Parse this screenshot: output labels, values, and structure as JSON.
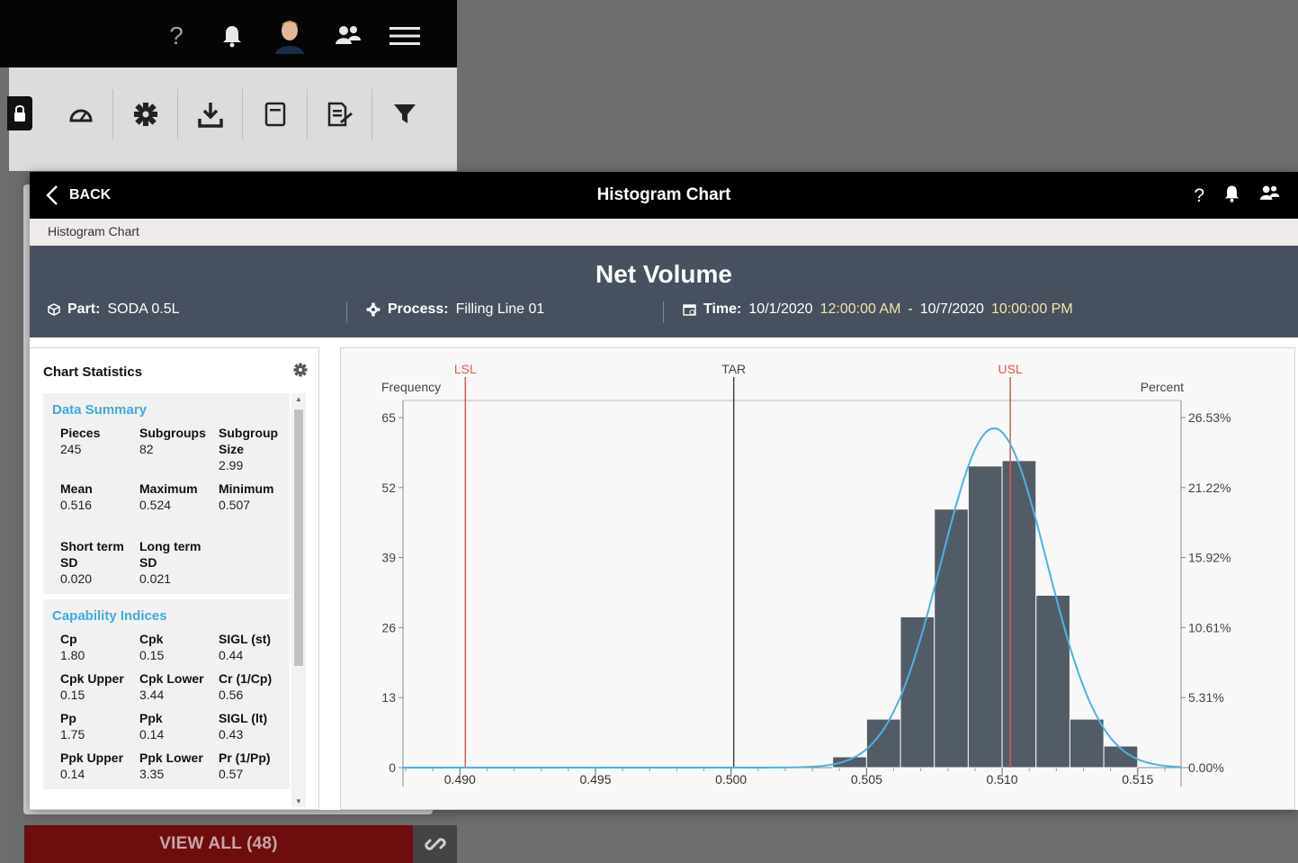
{
  "background": {
    "view_all_label": "VIEW ALL (48)",
    "topbar_icons": [
      "help-icon",
      "bell-icon",
      "avatar",
      "team-icon",
      "menu-icon"
    ],
    "help_glyph": "?",
    "toolbar_icons": [
      "lock-icon",
      "gauge-icon",
      "gear-icon",
      "download-icon",
      "report-icon",
      "edit-report-icon",
      "filter-icon"
    ]
  },
  "modal": {
    "back_label": "BACK",
    "title": "Histogram Chart",
    "help_glyph": "?",
    "breadcrumb": "Histogram Chart",
    "variable_name": "Net Volume",
    "part": {
      "label": "Part:",
      "value": "SODA 0.5L"
    },
    "process": {
      "label": "Process:",
      "value": "Filling Line 01"
    },
    "time": {
      "label": "Time:",
      "start_date": "10/1/2020",
      "start_time": "12:00:00 AM",
      "dash": "-",
      "end_date": "10/7/2020",
      "end_time": "10:00:00 PM"
    }
  },
  "stats": {
    "title": "Chart Statistics",
    "data_summary": {
      "title": "Data Summary",
      "items": [
        {
          "label": "Pieces",
          "value": "245"
        },
        {
          "label": "Subgroups",
          "value": "82"
        },
        {
          "label": "Subgroup Size",
          "value": "2.99"
        },
        {
          "label": "Mean",
          "value": "0.516"
        },
        {
          "label": "Maximum",
          "value": "0.524"
        },
        {
          "label": "Minimum",
          "value": "0.507"
        },
        {
          "label": "Short term SD",
          "value": "0.020"
        },
        {
          "label": "Long term SD",
          "value": "0.021"
        }
      ]
    },
    "capability": {
      "title": "Capability Indices",
      "items": [
        {
          "label": "Cp",
          "value": "1.80"
        },
        {
          "label": "Cpk",
          "value": "0.15"
        },
        {
          "label": "SIGL (st)",
          "value": "0.44"
        },
        {
          "label": "Cpk Upper",
          "value": "0.15"
        },
        {
          "label": "Cpk Lower",
          "value": "3.44"
        },
        {
          "label": "Cr (1/Cp)",
          "value": "0.56"
        },
        {
          "label": "Pp",
          "value": "1.75"
        },
        {
          "label": "Ppk",
          "value": "0.14"
        },
        {
          "label": "SIGL (lt)",
          "value": "0.43"
        },
        {
          "label": "Ppk Upper",
          "value": "0.14"
        },
        {
          "label": "Ppk Lower",
          "value": "3.35"
        },
        {
          "label": "Pr (1/Pp)",
          "value": "0.57"
        }
      ]
    }
  },
  "chart_data": {
    "type": "bar",
    "title": "",
    "ylabel_left": "Frequency",
    "ylabel_right": "Percent",
    "xlim": [
      0.4879,
      0.5166
    ],
    "ylim": [
      0,
      65
    ],
    "x_ticks": [
      "0.490",
      "0.495",
      "0.500",
      "0.505",
      "0.510",
      "0.515"
    ],
    "x_tick_values": [
      0.49,
      0.495,
      0.5,
      0.505,
      0.51,
      0.515
    ],
    "y_ticks": [
      0,
      13,
      26,
      39,
      52,
      65
    ],
    "y2_ticks": [
      "0.00%",
      "5.31%",
      "10.61%",
      "15.92%",
      "21.22%",
      "26.53%"
    ],
    "bin_width": 0.00125,
    "bins": [
      {
        "start": 0.50375,
        "count": 2
      },
      {
        "start": 0.505,
        "count": 9
      },
      {
        "start": 0.50625,
        "count": 28
      },
      {
        "start": 0.5075,
        "count": 48
      },
      {
        "start": 0.50875,
        "count": 56
      },
      {
        "start": 0.51,
        "count": 57
      },
      {
        "start": 0.51125,
        "count": 32
      },
      {
        "start": 0.5125,
        "count": 9
      },
      {
        "start": 0.51375,
        "count": 4
      }
    ],
    "bar_color": "#525c66",
    "curve": {
      "color": "#4cb3e0",
      "mean": 0.5097,
      "sd": 0.00195,
      "peak": 63
    },
    "spec_lines": [
      {
        "label": "LSL",
        "value": 0.4902,
        "color": "#e0564f"
      },
      {
        "label": "TAR",
        "value": 0.5001,
        "color": "#444444"
      },
      {
        "label": "USL",
        "value": 0.5103,
        "color": "#e0564f"
      }
    ]
  }
}
